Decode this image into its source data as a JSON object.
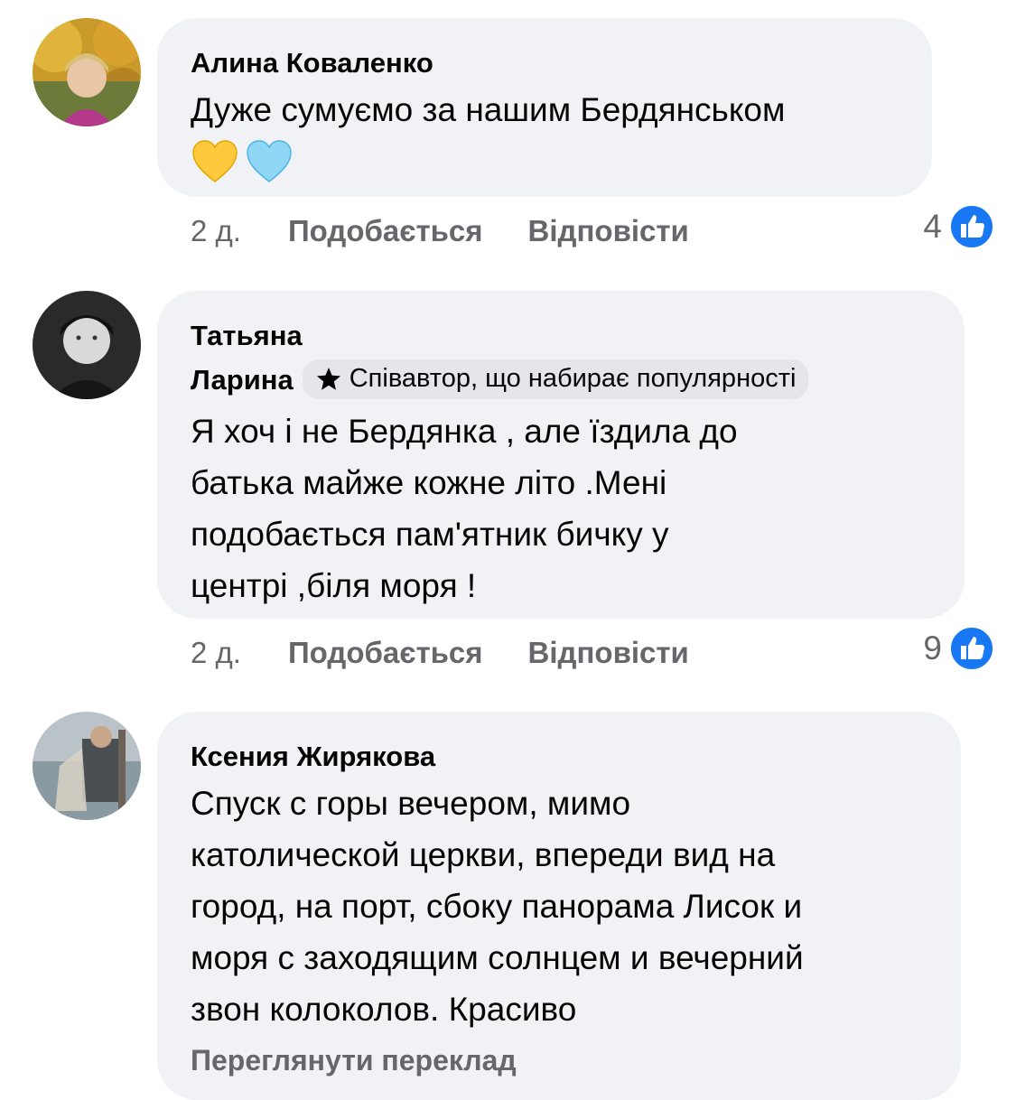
{
  "comments": [
    {
      "author": "Алина Коваленко",
      "text": "Дуже сумуємо за нашим Бердянськом",
      "emojis": [
        "yellow-heart",
        "light-blue-heart"
      ],
      "time": "2 д.",
      "like_label": "Подобається",
      "reply_label": "Відповісти",
      "like_count": "4"
    },
    {
      "author_line1": "Татьяна",
      "author_line2": "Ларина",
      "badge": "Співавтор, що набирає популярності",
      "text": "Я хоч і не Бердянка , але їздила до\nбатька майже кожне літо .Мені\nподобається пам'ятник бичку у\nцентрі ,біля моря !",
      "time": "2 д.",
      "like_label": "Подобається",
      "reply_label": "Відповісти",
      "like_count": "9"
    },
    {
      "author": "Ксения Жирякова",
      "text": "Спуск с горы вечером, мимо\nкатолической церкви, впереди вид на\nгород, на порт, сбоку панорама Лисок и\nморя с заходящим солнцем и вечерний\nзвон колоколов. Красиво",
      "see_translation": "Переглянути переклад"
    }
  ],
  "colors": {
    "bubble": "#f0f2f5",
    "meta_text": "#65676b",
    "like_blue": "#1877f2",
    "badge_bg": "#e4e6eb"
  }
}
